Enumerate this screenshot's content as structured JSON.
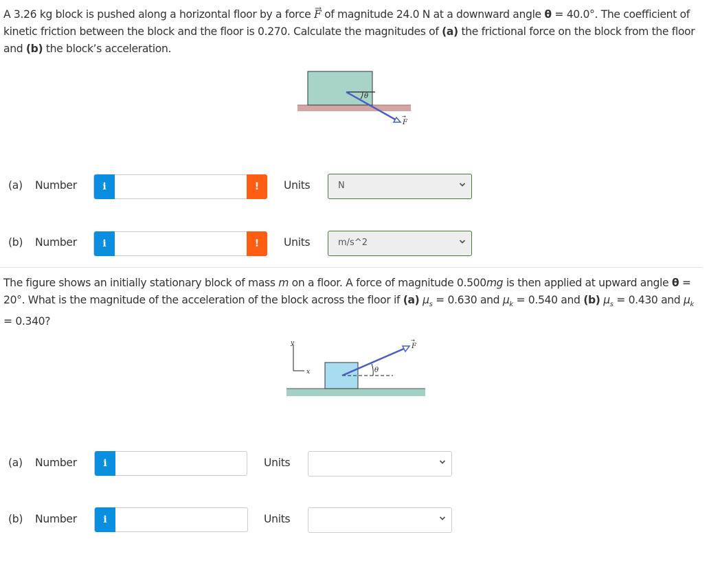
{
  "question1": {
    "text_parts": {
      "p1": "A 3.26 kg block is pushed along a horizontal floor by a force ",
      "force_symbol": "F",
      "p2": " of magnitude 24.0 N at a downward angle ",
      "theta": "θ",
      "p3": " = 40.0°. The coefficient of kinetic friction between the block and the floor is 0.270. Calculate the magnitudes of ",
      "a": "(a)",
      "p4": " the frictional force on the block from the floor and ",
      "b": "(b)",
      "p5": " the block’s acceleration."
    },
    "figure": {
      "angle_label": "θ",
      "force_label": "F",
      "block_color": "#a8d3c8",
      "floor_color": "#d4a5a5",
      "arrow_color": "#4a5fbf"
    },
    "answers": [
      {
        "part": "(a)",
        "number_label": "Number",
        "info_icon": "i",
        "warn_icon": "!",
        "value": "",
        "units_label": "Units",
        "unit_selected": "N"
      },
      {
        "part": "(b)",
        "number_label": "Number",
        "info_icon": "i",
        "warn_icon": "!",
        "value": "",
        "units_label": "Units",
        "unit_selected": "m/s^2"
      }
    ]
  },
  "question2": {
    "text_parts": {
      "p1": "The figure shows an initially stationary block of mass ",
      "m": "m",
      "p2": " on a floor. A force of magnitude 0.500",
      "mg": "mg",
      "p3": " is then applied at upward angle ",
      "theta": "θ",
      "p4": " = 20°. What is the magnitude of the acceleration of the block across the floor if ",
      "a": "(a)",
      "mus1": "μ",
      "s1": "s",
      "p5": " = 0.630 and ",
      "muk1": "μ",
      "k1": "k",
      "p6": " = 0.540 and ",
      "b": "(b)",
      "mus2": "μ",
      "s2": "s",
      "p7": " = 0.430 and ",
      "muk2": "μ",
      "k2": "k",
      "p8": " = 0.340?"
    },
    "figure": {
      "angle_label": "θ",
      "force_label": "F",
      "x_label": "x",
      "y_label": "y",
      "block_color": "#a8dcf0",
      "floor_color": "#a3d0c4",
      "arrow_color": "#4a5fbf"
    },
    "answers": [
      {
        "part": "(a)",
        "number_label": "Number",
        "info_icon": "i",
        "value": "",
        "units_label": "Units",
        "unit_selected": ""
      },
      {
        "part": "(b)",
        "number_label": "Number",
        "info_icon": "i",
        "value": "",
        "units_label": "Units",
        "unit_selected": ""
      }
    ]
  }
}
